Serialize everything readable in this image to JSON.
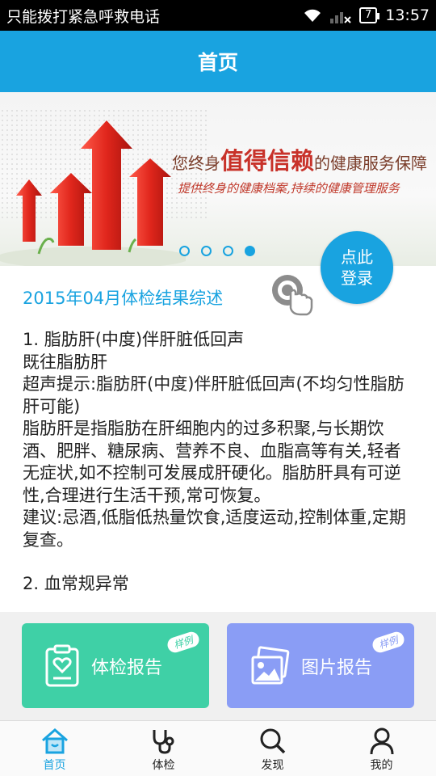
{
  "status_bar": {
    "carrier": "只能拨打紧急呼救电话",
    "battery": "7",
    "time": "13:57"
  },
  "app_bar": {
    "title": "首页"
  },
  "banner": {
    "tagline_prefix": "您终身",
    "tagline_highlight": "值得信赖",
    "tagline_suffix": "的健康服务保障",
    "subtitle": "提供终身的健康档案,持续的健康管理服务",
    "slide_count": 4,
    "active_slide": 4
  },
  "login_button": {
    "line1": "点此",
    "line2": "登录"
  },
  "report": {
    "title": "2015年04月体检结果综述",
    "paragraphs": [
      "1. 脂肪肝(中度)伴肝脏低回声",
      "既往脂肪肝",
      "超声提示:脂肪肝(中度)伴肝脏低回声(不均匀性脂肪肝可能)",
      "脂肪肝是指脂肪在肝细胞内的过多积聚,与长期饮酒、肥胖、糖尿病、营养不良、血脂高等有关,轻者无症状,如不控制可发展成肝硬化。脂肪肝具有可逆性,合理进行生活干预,常可恢复。",
      "建议:忌酒,低脂低热量饮食,适度运动,控制体重,定期复查。"
    ],
    "next_item_partial": "2. 血常规异常"
  },
  "actions": {
    "exam_report": {
      "label": "体检报告",
      "badge": "样例"
    },
    "photo_report": {
      "label": "图片报告",
      "badge": "样例"
    }
  },
  "bottom_nav": [
    {
      "label": "首页",
      "icon": "home-icon",
      "active": true
    },
    {
      "label": "体检",
      "icon": "stethoscope-icon",
      "active": false
    },
    {
      "label": "发现",
      "icon": "search-icon",
      "active": false
    },
    {
      "label": "我的",
      "icon": "person-icon",
      "active": false
    }
  ],
  "colors": {
    "primary": "#19a3e0",
    "exam_card": "#3fd0a6",
    "photo_card": "#8a9df5",
    "banner_red": "#c8322a"
  }
}
